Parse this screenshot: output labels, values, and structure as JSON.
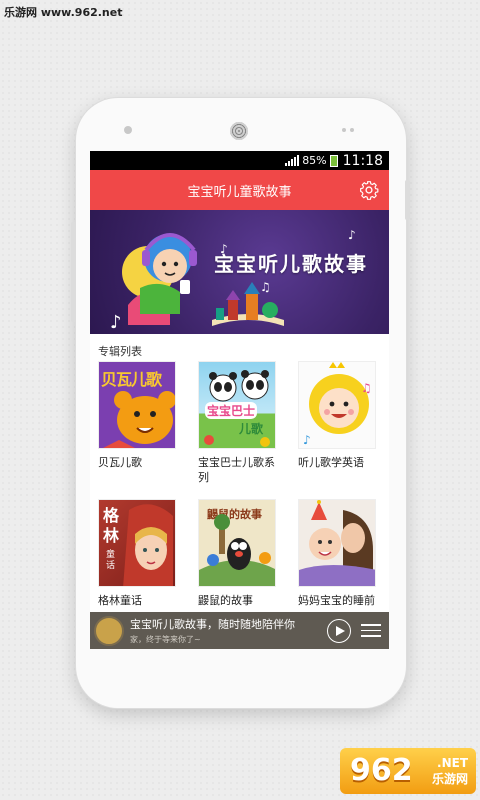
{
  "watermark": {
    "top_text": "乐游网 www.962.net",
    "logo_number": "962",
    "logo_net": ".NET",
    "logo_cn": "乐游网"
  },
  "status_bar": {
    "battery_percent": "85%",
    "time": "11:18"
  },
  "app_bar": {
    "title": "宝宝听儿童歌故事"
  },
  "banner": {
    "title": "宝宝听儿歌故事"
  },
  "section": {
    "title": "专辑列表"
  },
  "albums": [
    {
      "name": "贝瓦儿歌"
    },
    {
      "name": "宝宝巴士儿歌系列"
    },
    {
      "name": "听儿歌学英语"
    },
    {
      "name": "格林童话"
    },
    {
      "name": "鼹鼠的故事"
    },
    {
      "name": "妈妈宝宝的睡前"
    }
  ],
  "cover_text": {
    "beiwa": "贝瓦儿歌",
    "babybus": "宝宝巴士",
    "babybus_sub": "儿歌",
    "grimm": "格林",
    "grimm_sub": "童话",
    "mole": "鼹鼠的故事"
  },
  "player": {
    "title": "宝宝听儿歌故事，随时随地陪伴你",
    "subtitle": "家，终于等来你了~"
  },
  "colors": {
    "accent": "#f04848",
    "banner_bg": "#3b2366",
    "player_bg": "#5f5a52"
  }
}
